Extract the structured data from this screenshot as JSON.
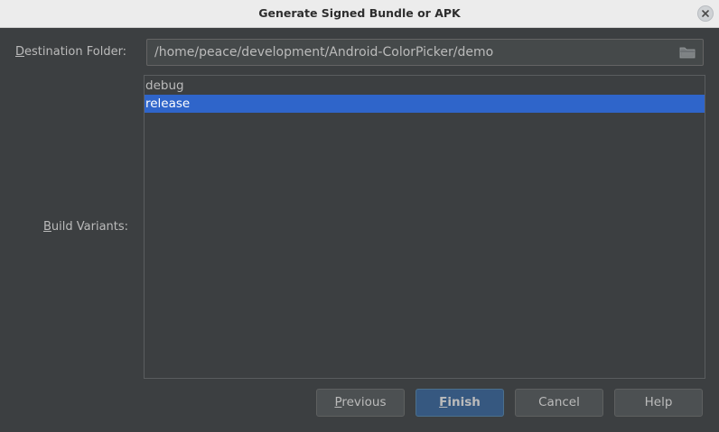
{
  "window": {
    "title": "Generate Signed Bundle or APK"
  },
  "form": {
    "destination_label": {
      "mnemonic": "D",
      "rest": "estination Folder:"
    },
    "destination_value": "/home/peace/development/Android-ColorPicker/demo",
    "build_variants_label": {
      "mnemonic": "B",
      "rest": "uild Variants:"
    },
    "build_variants": [
      {
        "label": "debug",
        "selected": false
      },
      {
        "label": "release",
        "selected": true
      }
    ]
  },
  "buttons": {
    "previous": {
      "mnemonic": "P",
      "rest": "revious"
    },
    "finish": {
      "mnemonic": "F",
      "rest": "inish"
    },
    "cancel": "Cancel",
    "help": "Help"
  },
  "colors": {
    "dialog_bg": "#3c3f41",
    "selection": "#2f65ca",
    "default_button": "#365880",
    "titlebar": "#ececec"
  },
  "icons": {
    "close": "close-icon",
    "folder": "folder-icon"
  }
}
